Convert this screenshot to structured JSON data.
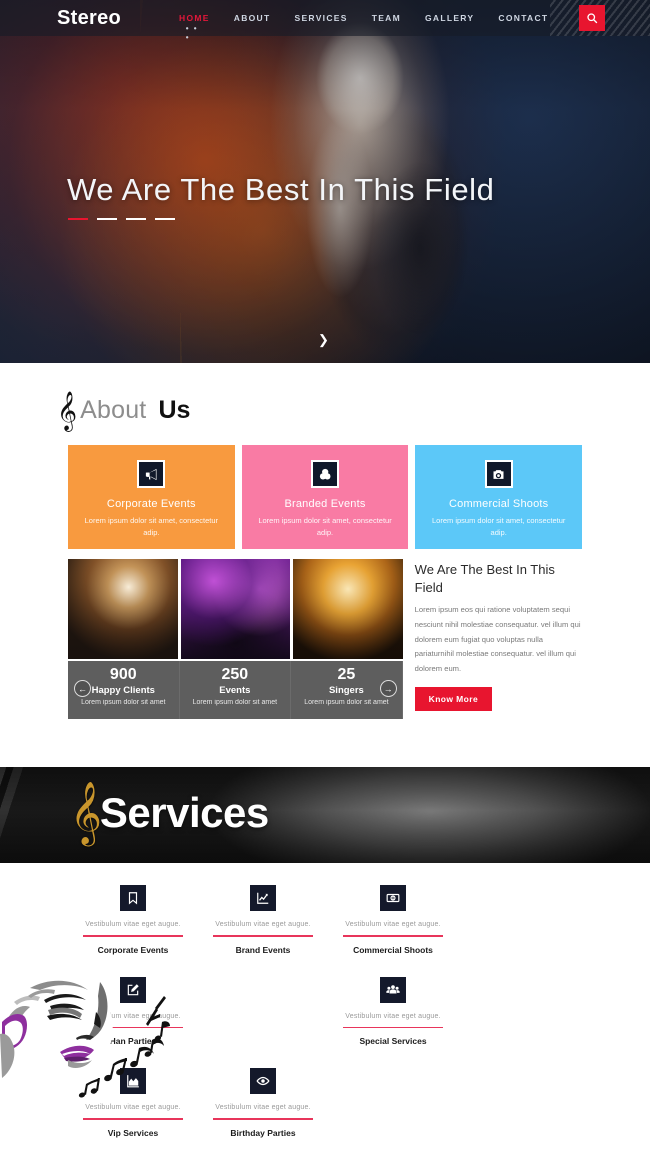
{
  "header": {
    "brand": "Stereo",
    "nav": [
      {
        "label": "HOME",
        "active": true
      },
      {
        "label": "ABOUT",
        "active": false
      },
      {
        "label": "SERVICES",
        "active": false
      },
      {
        "label": "TEAM",
        "active": false
      },
      {
        "label": "GALLERY",
        "active": false
      },
      {
        "label": "CONTACT",
        "active": false
      }
    ],
    "active_dots": "• • •",
    "search_icon": "search-icon",
    "accent_color": "#e8152f"
  },
  "hero": {
    "title": "We Are The Best In This Field",
    "scroll_icon": "chevron-down-icon"
  },
  "about": {
    "heading_icon": "treble-clef-icon",
    "heading_light": "About",
    "heading_bold": "Us",
    "cards": [
      {
        "title": "Corporate Events",
        "text": "Lorem ipsum dolor sit amet, consectetur adip.",
        "color": "#f89a3f",
        "icon": "megaphone-icon"
      },
      {
        "title": "Branded Events",
        "text": "Lorem ipsum dolor sit amet, consectetur adip.",
        "color": "#f97ba4",
        "icon": "layers-icon"
      },
      {
        "title": "Commercial Shoots",
        "text": "Lorem ipsum dolor sit amet, consectetur adip.",
        "color": "#5cc8f8",
        "icon": "camera-icon"
      }
    ],
    "counters": [
      {
        "number": "900",
        "label": "Happy Clients",
        "sub": "Lorem ipsum dolor sit amet"
      },
      {
        "number": "250",
        "label": "Events",
        "sub": "Lorem ipsum dolor sit amet"
      },
      {
        "number": "25",
        "label": "Singers",
        "sub": "Lorem ipsum dolor sit amet"
      }
    ],
    "carousel_prev": "←",
    "carousel_next": "→",
    "right_title": "We Are The Best In This Field",
    "right_text": "Lorem ipsum eos qui ratione voluptatem sequi nesciunt nihil molestiae consequatur. vel illum qui dolorem eum fugiat quo voluptas nulla pariaturnihil molestiae consequatur. vel illum qui dolorem eum.",
    "button_label": "Know More"
  },
  "services": {
    "heading_icon": "treble-clef-icon",
    "heading": "Services",
    "items": [
      {
        "icon": "bookmark-icon",
        "desc": "Vestibulum vitae eget augue.",
        "name": "Corporate Events"
      },
      {
        "icon": "chart-line-icon",
        "desc": "Vestibulum vitae eget augue.",
        "name": "Brand Events"
      },
      {
        "icon": "money-icon",
        "desc": "Vestibulum vitae eget augue.",
        "name": "Commercial Shoots"
      },
      {
        "icon": "edit-icon",
        "desc": "Vestibulum vitae eget augue.",
        "name": "Han Parties"
      },
      {
        "icon": "users-icon",
        "desc": "Vestibulum vitae eget augue.",
        "name": "Special Services"
      },
      {
        "icon": "area-chart-icon",
        "desc": "Vestibulum vitae eget augue.",
        "name": "Vip Services"
      },
      {
        "icon": "eye-icon",
        "desc": "Vestibulum vitae eget augue.",
        "name": "Birthday Parties"
      }
    ],
    "rule_color": "#e8355b"
  }
}
